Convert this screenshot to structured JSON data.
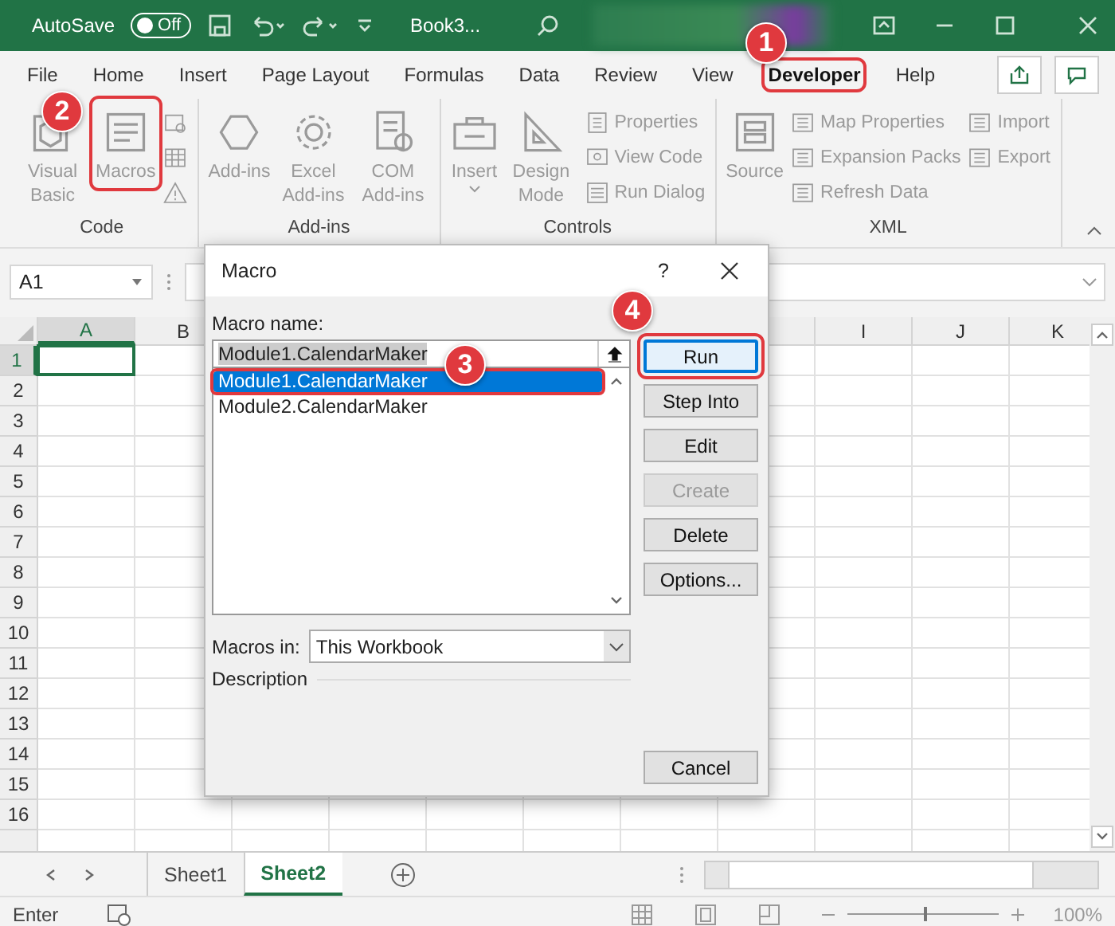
{
  "title_bar": {
    "autosave_label": "AutoSave",
    "autosave_toggle": {
      "label": "Off",
      "on": false
    },
    "document_title": "Book3..."
  },
  "ribbon_tabs": [
    {
      "label": "File",
      "selected": false
    },
    {
      "label": "Home",
      "selected": false
    },
    {
      "label": "Insert",
      "selected": false
    },
    {
      "label": "Page Layout",
      "selected": false
    },
    {
      "label": "Formulas",
      "selected": false
    },
    {
      "label": "Data",
      "selected": false
    },
    {
      "label": "Review",
      "selected": false
    },
    {
      "label": "View",
      "selected": false
    },
    {
      "label": "Developer",
      "selected": true,
      "highlighted": true
    },
    {
      "label": "Help",
      "selected": false
    }
  ],
  "ribbon_groups": [
    {
      "label": "Code",
      "large": [
        {
          "label": "Visual Basic",
          "highlighted": false
        },
        {
          "label": "Macros",
          "highlighted": true
        }
      ],
      "small": [
        [
          {
            "kind": "icon_only"
          },
          {
            "kind": "icon_only"
          },
          {
            "kind": "icon_only"
          }
        ]
      ]
    },
    {
      "label": "Add-ins",
      "large": [
        {
          "label": "Add-ins"
        },
        {
          "label": "Excel Add-ins"
        },
        {
          "label": "COM Add-ins"
        }
      ]
    },
    {
      "label": "Controls",
      "large": [
        {
          "label": "Insert"
        },
        {
          "label": "Design Mode"
        }
      ],
      "small": [
        [
          {
            "label": "Properties"
          },
          {
            "label": "View Code"
          },
          {
            "label": "Run Dialog"
          }
        ]
      ]
    },
    {
      "label": "XML",
      "large": [
        {
          "label": "Source"
        }
      ],
      "small": [
        [
          {
            "label": "Map Properties"
          },
          {
            "label": "Expansion Packs"
          },
          {
            "label": "Refresh Data"
          }
        ],
        [
          {
            "label": "Import"
          },
          {
            "label": "Export"
          }
        ]
      ]
    }
  ],
  "formula_bar": {
    "name_box": "A1"
  },
  "grid": {
    "columns_left": [
      {
        "label": "A",
        "selected": true
      },
      {
        "label": "B",
        "selected": false
      }
    ],
    "columns_right": [
      {
        "label": "I",
        "selected": false
      },
      {
        "label": "J",
        "selected": false
      },
      {
        "label": "K",
        "selected": false
      }
    ],
    "rows": [
      {
        "label": "1",
        "selected": true
      },
      {
        "label": "2",
        "selected": false
      },
      {
        "label": "3",
        "selected": false
      },
      {
        "label": "4",
        "selected": false
      },
      {
        "label": "5",
        "selected": false
      },
      {
        "label": "6",
        "selected": false
      },
      {
        "label": "7",
        "selected": false
      },
      {
        "label": "8",
        "selected": false
      },
      {
        "label": "9",
        "selected": false
      },
      {
        "label": "10",
        "selected": false
      },
      {
        "label": "11",
        "selected": false
      },
      {
        "label": "12",
        "selected": false
      },
      {
        "label": "13",
        "selected": false
      },
      {
        "label": "14",
        "selected": false
      },
      {
        "label": "15",
        "selected": false
      },
      {
        "label": "16",
        "selected": false
      }
    ]
  },
  "dialog": {
    "title": "Macro",
    "help": "?",
    "name_label": "Macro name:",
    "name_value": "Module1.CalendarMaker",
    "macros": [
      {
        "label": "Module1.CalendarMaker",
        "selected": true,
        "highlighted": true
      },
      {
        "label": "Module2.CalendarMaker",
        "selected": false,
        "highlighted": false
      }
    ],
    "buttons": [
      {
        "label": "Run",
        "kind": "default",
        "disabled": false,
        "highlighted": true
      },
      {
        "label": "Step Into",
        "kind": "normal",
        "disabled": false
      },
      {
        "label": "Edit",
        "kind": "normal",
        "disabled": false
      },
      {
        "label": "Create",
        "kind": "normal",
        "disabled": true
      },
      {
        "label": "Delete",
        "kind": "normal",
        "disabled": false
      },
      {
        "label": "Options...",
        "kind": "normal",
        "disabled": false
      },
      {
        "label": "Cancel",
        "kind": "bottom",
        "disabled": false
      }
    ],
    "macros_in_label": "Macros in:",
    "macros_in_value": "This Workbook",
    "description_label": "Description"
  },
  "sheet_tabs": [
    {
      "label": "Sheet1",
      "selected": false
    },
    {
      "label": "Sheet2",
      "selected": true
    }
  ],
  "status_bar": {
    "mode": "Enter",
    "zoom": "100%",
    "zoom_level": {
      "level": 0.5
    }
  },
  "annotations": [
    {
      "number": "1"
    },
    {
      "number": "2"
    },
    {
      "number": "3"
    },
    {
      "number": "4"
    }
  ]
}
